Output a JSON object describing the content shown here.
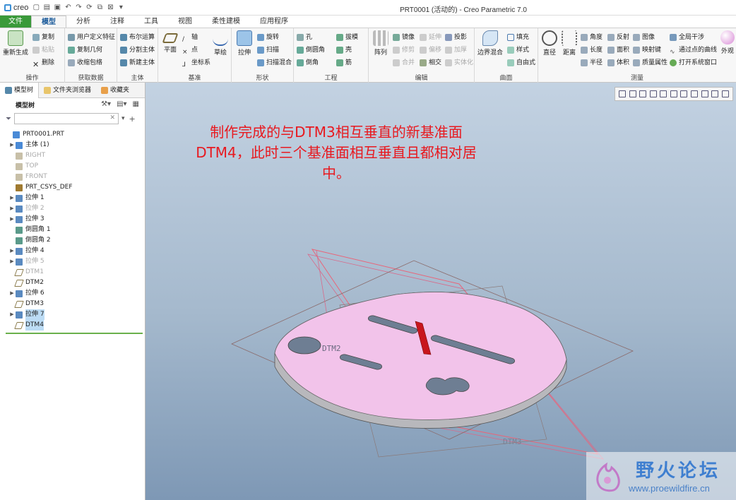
{
  "app": {
    "logo": "creo",
    "window_title": "PRT0001 (活动的) - Creo Parametric 7.0"
  },
  "tabs": [
    {
      "label": "文件"
    },
    {
      "label": "模型"
    },
    {
      "label": "分析"
    },
    {
      "label": "注释"
    },
    {
      "label": "工具"
    },
    {
      "label": "视图"
    },
    {
      "label": "柔性建模"
    },
    {
      "label": "应用程序"
    }
  ],
  "ribbon": {
    "operations": {
      "label": "操作",
      "regenerate": "重新生成",
      "copy": "复制",
      "paste": "粘贴",
      "delete": "删除"
    },
    "get_data": {
      "label": "获取数据",
      "udf": "用户定义特征",
      "copy_geom": "复制几何",
      "shrinkwrap": "收缩包络"
    },
    "body": {
      "label": "主体",
      "boolean": "布尔运算",
      "split": "分割主体",
      "new_body": "新建主体"
    },
    "datum": {
      "label": "基准",
      "plane": "平面",
      "axis": "轴",
      "point": "点",
      "csys": "坐标系",
      "sketch": "草绘"
    },
    "shapes": {
      "label": "形状",
      "extrude": "拉伸",
      "revolve": "旋转",
      "sweep": "扫描",
      "swept_blend": "扫描混合"
    },
    "engineering": {
      "label": "工程",
      "hole": "孔",
      "round": "倒圆角",
      "chamfer": "倒角",
      "draft": "拔模",
      "shell": "壳",
      "rib": "筋"
    },
    "editing": {
      "label": "编辑",
      "pattern": "阵列",
      "mirror": "镜像",
      "trim": "修剪",
      "merge": "合并",
      "extend": "延伸",
      "offset": "偏移",
      "intersect": "相交",
      "project": "投影",
      "thicken": "加厚",
      "solidify": "实体化"
    },
    "surfaces": {
      "label": "曲面",
      "boundary": "边界混合",
      "fill": "填充",
      "style": "样式",
      "freestyle": "自由式"
    },
    "measure": {
      "label": "测量",
      "diameter": "直径",
      "distance": "距离",
      "angle": "角度",
      "length": "长度",
      "radius": "半径",
      "reflect": "反射",
      "area": "面积",
      "volume": "体积",
      "image": "图像",
      "map_key": "映射键",
      "mass_props": "质量属性",
      "global_interference": "全局干涉",
      "curve_through": "通过点的曲线",
      "sys_window": "打开系统窗口",
      "appearance": "外观"
    }
  },
  "panel": {
    "tabs": [
      "模型树",
      "文件夹浏览器",
      "收藏夹"
    ],
    "header": "模型树",
    "filter_placeholder": "",
    "tree": [
      {
        "label": "PRT0001.PRT",
        "state": "normal",
        "arrow": ""
      },
      {
        "label": "主体 (1)",
        "state": "normal",
        "arrow": "▶"
      },
      {
        "label": "RIGHT",
        "state": "gray",
        "arrow": ""
      },
      {
        "label": "TOP",
        "state": "gray",
        "arrow": ""
      },
      {
        "label": "FRONT",
        "state": "gray",
        "arrow": ""
      },
      {
        "label": "PRT_CSYS_DEF",
        "state": "normal",
        "arrow": ""
      },
      {
        "label": "拉伸 1",
        "state": "normal",
        "arrow": "▶"
      },
      {
        "label": "拉伸 2",
        "state": "gray",
        "arrow": "▶"
      },
      {
        "label": "拉伸 3",
        "state": "normal",
        "arrow": "▶"
      },
      {
        "label": "倒圆角 1",
        "state": "normal",
        "arrow": ""
      },
      {
        "label": "倒圆角 2",
        "state": "normal",
        "arrow": ""
      },
      {
        "label": "拉伸 4",
        "state": "normal",
        "arrow": "▶"
      },
      {
        "label": "拉伸 5",
        "state": "gray",
        "arrow": "▶"
      },
      {
        "label": "DTM1",
        "state": "gray",
        "arrow": ""
      },
      {
        "label": "DTM2",
        "state": "normal",
        "arrow": ""
      },
      {
        "label": "拉伸 6",
        "state": "normal",
        "arrow": "▶"
      },
      {
        "label": "DTM3",
        "state": "normal",
        "arrow": ""
      },
      {
        "label": "拉伸 7",
        "state": "selected",
        "arrow": "▶"
      },
      {
        "label": "DTM4",
        "state": "selected",
        "arrow": ""
      }
    ]
  },
  "viewport": {
    "note_lines": [
      "制作完成的与DTM3相互垂直的新基准面",
      "DTM4，此时三个基准面相互垂直且都相对居",
      "中。"
    ],
    "datum_labels": [
      "DTM2",
      "DTM3"
    ],
    "watermark_cn": "野火论坛",
    "watermark_url": "www.proewildfire.cn"
  },
  "colors": {
    "file_tab": "#3a9a3a",
    "note": "#e8191f",
    "part_top": "#f2c3ea",
    "selection": "#bcdcf5"
  }
}
